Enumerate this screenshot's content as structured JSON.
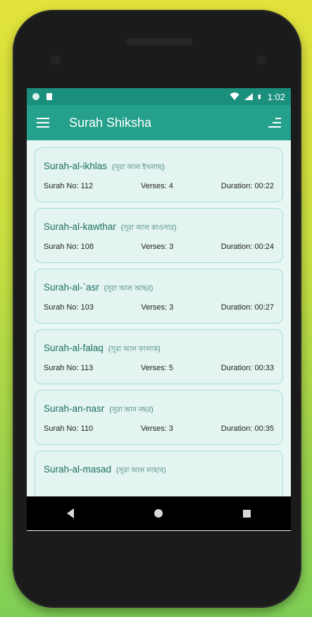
{
  "status_bar": {
    "time": "1:02"
  },
  "toolbar": {
    "title": "Surah Shiksha"
  },
  "surahs": [
    {
      "name": "Surah-al-ikhlas",
      "bangla": "(সূরা আল ইখলাছ)",
      "surah_no": "Surah No: 112",
      "verses": "Verses: 4",
      "duration": "Duration: 00:22"
    },
    {
      "name": "Surah-al-kawthar",
      "bangla": "(সূরা আল কাওসার)",
      "surah_no": "Surah No: 108",
      "verses": "Verses: 3",
      "duration": "Duration: 00:24"
    },
    {
      "name": "Surah-al-`asr",
      "bangla": "(সূরা আল আছর)",
      "surah_no": "Surah No: 103",
      "verses": "Verses: 3",
      "duration": "Duration: 00:27"
    },
    {
      "name": "Surah-al-falaq",
      "bangla": "(সূরা আল ফালাক)",
      "surah_no": "Surah No: 113",
      "verses": "Verses: 5",
      "duration": "Duration: 00:33"
    },
    {
      "name": "Surah-an-nasr",
      "bangla": "(সূরা আন নছর)",
      "surah_no": "Surah No: 110",
      "verses": "Verses: 3",
      "duration": "Duration: 00:35"
    },
    {
      "name": "Surah-al-masad",
      "bangla": "(সূরা আল লাহাব)",
      "surah_no": "",
      "verses": "",
      "duration": ""
    }
  ],
  "icons": {
    "menu": "menu-icon",
    "sort": "sort-icon",
    "wifi": "wifi-icon",
    "signal": "signal-icon",
    "battery": "battery-icon",
    "back": "back-icon",
    "home": "home-icon",
    "recent": "recent-apps-icon"
  },
  "colors": {
    "primary": "#25a08c",
    "status": "#1a8f7d",
    "card_bg": "#e3f4f1",
    "card_border": "#a7ddd2"
  }
}
